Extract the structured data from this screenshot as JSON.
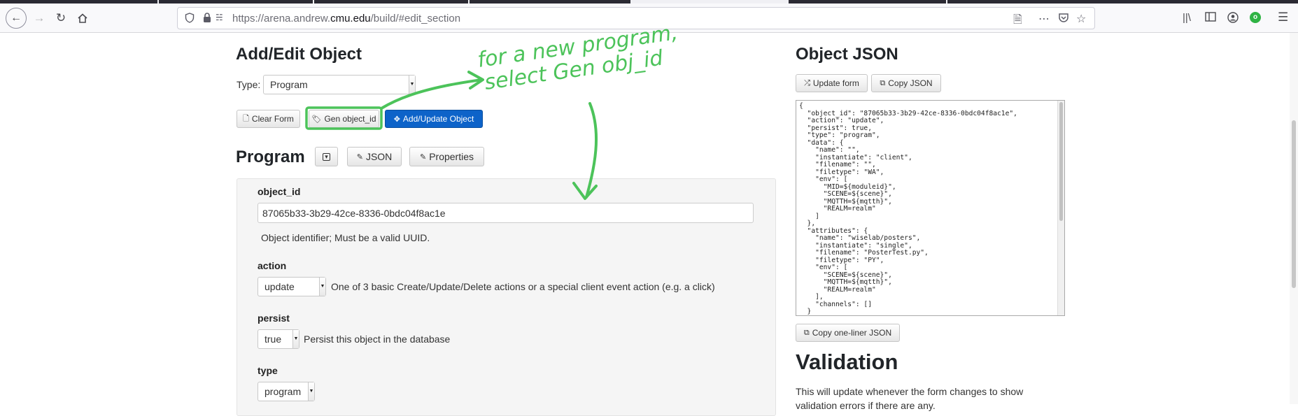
{
  "browser": {
    "url_prefix": "https://arena.andrew.",
    "url_domain": "cmu.edu",
    "url_path": "/build/#edit_section",
    "icons": {
      "back": "arrow-left-icon",
      "forward": "arrow-right-icon",
      "reload": "reload-icon",
      "home": "home-icon",
      "shield": "shield-icon",
      "lock": "lock-icon",
      "permissions": "permissions-icon",
      "reader": "reader-view-icon",
      "more": "more-icon",
      "pocket": "pocket-icon",
      "star": "star-icon",
      "library": "library-icon",
      "sidebar": "sidebar-icon",
      "account": "account-icon",
      "extension": "extension-icon",
      "menu": "menu-icon"
    }
  },
  "editor": {
    "title": "Add/Edit Object",
    "type_label": "Type:",
    "type_value": "Program",
    "clear_form": "Clear Form",
    "gen_object_id": "Gen object_id",
    "add_update": "Add/Update Object"
  },
  "program": {
    "title": "Program",
    "json_button": "JSON",
    "properties_button": "Properties"
  },
  "form": {
    "object_id_label": "object_id",
    "object_id_value": "87065b33-3b29-42ce-8336-0bdc04f8ac1e",
    "object_id_help": "Object identifier; Must be a valid UUID.",
    "action_label": "action",
    "action_value": "update",
    "action_help": "One of 3 basic Create/Update/Delete actions or a special client event action (e.g. a click)",
    "persist_label": "persist",
    "persist_value": "true",
    "persist_help": "Persist this object in the database",
    "type_label": "type",
    "type_value": "program"
  },
  "json_panel": {
    "title": "Object JSON",
    "update_form": "Update form",
    "copy_json": "Copy JSON",
    "copy_one_liner": "Copy one-liner JSON",
    "content": "{\n  \"object_id\": \"87065b33-3b29-42ce-8336-0bdc04f8ac1e\",\n  \"action\": \"update\",\n  \"persist\": true,\n  \"type\": \"program\",\n  \"data\": {\n    \"name\": \"\",\n    \"instantiate\": \"client\",\n    \"filename\": \"\",\n    \"filetype\": \"WA\",\n    \"env\": [\n      \"MID=${moduleid}\",\n      \"SCENE=${scene}\",\n      \"MQTTH=${mqtth}\",\n      \"REALM=realm\"\n    ]\n  },\n  \"attributes\": {\n    \"name\": \"wiselab/posters\",\n    \"instantiate\": \"single\",\n    \"filename\": \"PosterTest.py\",\n    \"filetype\": \"PY\",\n    \"env\": [\n      \"SCENE=${scene}\",\n      \"MQTTH=${mqtth}\",\n      \"REALM=realm\"\n    ],\n    \"channels\": []\n  }\n}"
  },
  "validation": {
    "title": "Validation",
    "text": "This will update whenever the form changes to show validation errors if there are any."
  },
  "annotation": {
    "line1": "for a new program,",
    "line2": "select Gen obj_id",
    "color": "#4cc35a"
  }
}
